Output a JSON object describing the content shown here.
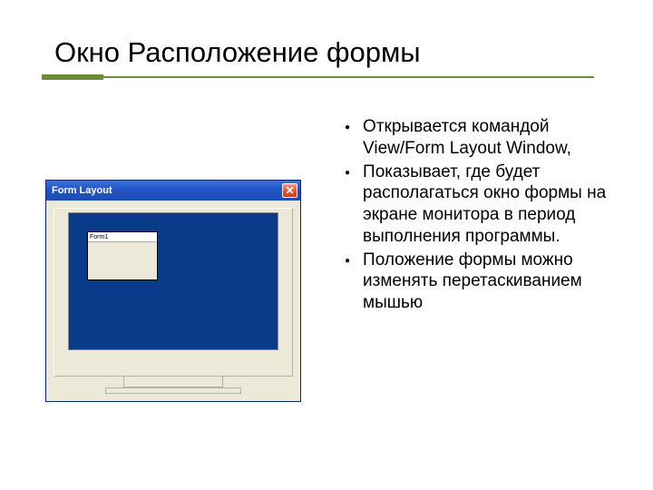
{
  "title": "Окно Расположение формы",
  "window": {
    "title_label": "Form Layout",
    "close_label": "✕",
    "form_label": "Form1"
  },
  "bullets": [
    {
      "text": "Открывается командой View/Form Layout Window,"
    },
    {
      "text": "Показывает, где будет располагаться окно формы на экране монитора в период выполнения программы."
    },
    {
      "text": " Положение формы можно изменять перетаскиванием мышью"
    }
  ]
}
